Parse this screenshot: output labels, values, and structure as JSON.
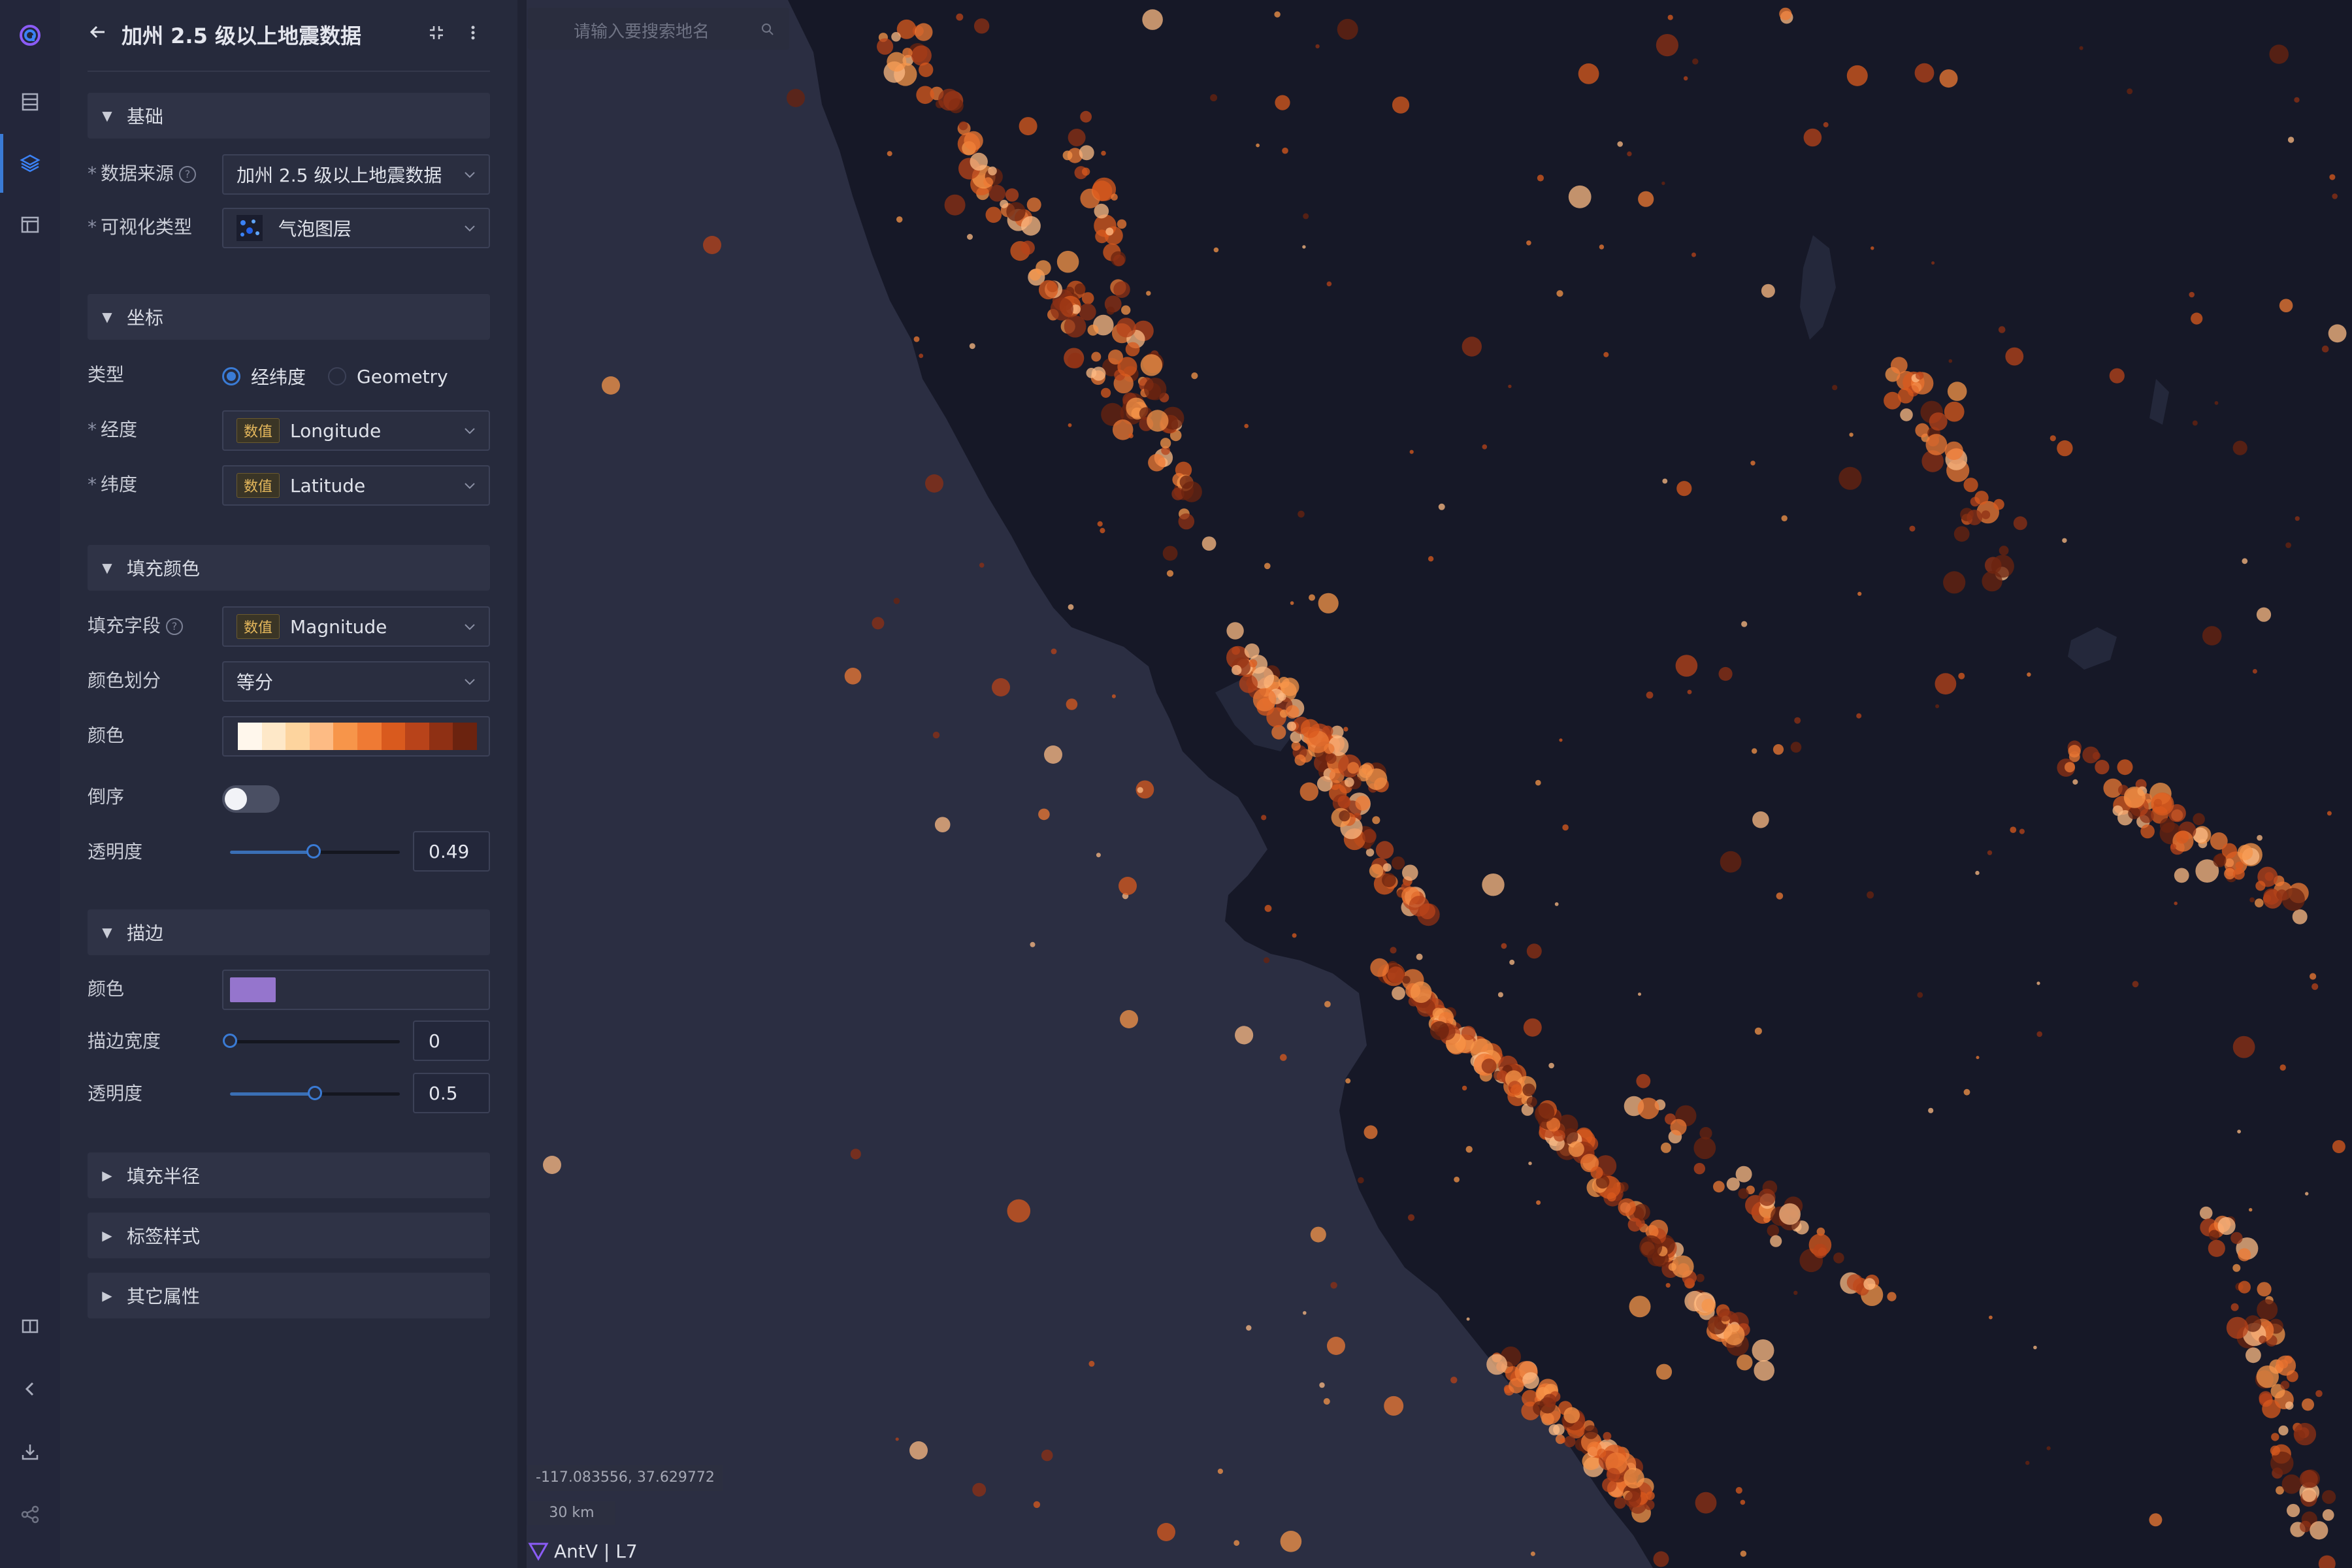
{
  "rail": {
    "icons": [
      "logo-icon",
      "dataset-icon",
      "layers-icon",
      "layout-icon",
      "guide-icon",
      "collapse-icon",
      "download-icon",
      "share-icon"
    ]
  },
  "panel": {
    "title": "加州 2.5 级以上地震数据",
    "sections": {
      "basic": "基础",
      "coords": "坐标",
      "fill": "填充颜色",
      "stroke": "描边",
      "radius": "填充半径",
      "label": "标签样式",
      "other": "其它属性"
    },
    "basic": {
      "source_label": "数据来源",
      "source_value": "加州 2.5 级以上地震数据",
      "vis_label": "可视化类型",
      "vis_value": "气泡图层"
    },
    "coords": {
      "type_label": "类型",
      "type_options": [
        "经纬度",
        "Geometry"
      ],
      "type_selected": "经纬度",
      "lng_label": "经度",
      "lat_label": "纬度",
      "tag": "数值",
      "lng_value": "Longitude",
      "lat_value": "Latitude"
    },
    "fill": {
      "field_label": "填充字段",
      "field_tag": "数值",
      "field_value": "Magnitude",
      "divide_label": "颜色划分",
      "divide_value": "等分",
      "color_label": "颜色",
      "palette": [
        "#fff7ec",
        "#fee8c8",
        "#fdd49e",
        "#fdbb84",
        "#f7954a",
        "#ef7a34",
        "#d95a1e",
        "#b8431a",
        "#8f3014",
        "#6b230f"
      ],
      "reverse_label": "倒序",
      "reverse_on": false,
      "opacity_label": "透明度",
      "opacity_value": "0.49"
    },
    "stroke": {
      "color_label": "颜色",
      "color": "#9575cd",
      "width_label": "描边宽度",
      "width_value": "0",
      "opacity_label": "透明度",
      "opacity_value": "0.5"
    }
  },
  "map": {
    "search_placeholder": "请输入要搜索地名",
    "coordinates": "-117.083556, 37.629772",
    "scale": "30 km",
    "brand": "AntV | L7",
    "colors": {
      "ocean": "#2b2e42",
      "land": "#161827",
      "water_body": "#24283b",
      "quake": "#e87a34"
    }
  }
}
